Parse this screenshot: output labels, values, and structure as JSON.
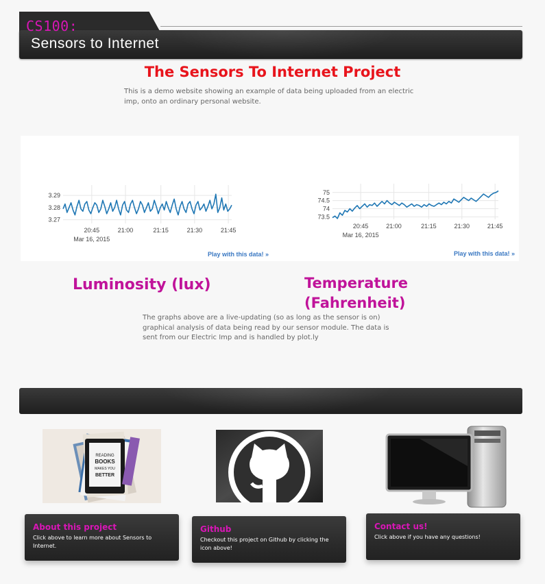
{
  "header": {
    "course_code": "CS100:",
    "site_title": "Sensors to Internet"
  },
  "intro": {
    "title": "The Sensors To Internet Project",
    "text": "This is a demo website showing an example of data being uploaded from an electric imp, onto an ordinary personal website."
  },
  "charts": {
    "play_link": "Play with this data! »",
    "labels": {
      "luminosity": "Luminosity (lux)",
      "temperature": "Temperature (Fahrenheit)"
    },
    "description": "The graphs above are a live-updating (so as long as the sensor is on) graphical analysis of data being read by our sensor module. The data is sent from our Electric Imp and is handled by plot.ly"
  },
  "chart_data": [
    {
      "type": "line",
      "title": "",
      "xlabel": "",
      "ylabel": "",
      "x_ticks": [
        "20:45",
        "21:00",
        "21:15",
        "21:30",
        "21:45"
      ],
      "x_sublabel": "Mar 16, 2015",
      "y_ticks": [
        3.27,
        3.28,
        3.29
      ],
      "ylim": [
        3.267,
        3.294
      ],
      "xlim_minutes": [
        20.5,
        21.8
      ],
      "line_color": "#1f77b4",
      "grid": true,
      "series": [
        {
          "values": [
            3.279,
            3.283,
            3.276,
            3.28,
            3.284,
            3.278,
            3.274,
            3.281,
            3.286,
            3.279,
            3.277,
            3.283,
            3.285,
            3.278,
            3.275,
            3.28,
            3.284,
            3.282,
            3.276,
            3.279,
            3.286,
            3.281,
            3.275,
            3.279,
            3.284,
            3.277,
            3.28,
            3.286,
            3.279,
            3.274,
            3.282,
            3.285,
            3.278,
            3.276,
            3.283,
            3.286,
            3.28,
            3.275,
            3.279,
            3.285,
            3.282,
            3.276,
            3.28,
            3.284,
            3.277,
            3.279,
            3.286,
            3.281,
            3.275,
            3.28,
            3.283,
            3.278,
            3.285,
            3.28,
            3.276,
            3.282,
            3.287,
            3.279,
            3.274,
            3.281,
            3.285,
            3.279,
            3.276,
            3.283,
            3.285,
            3.279,
            3.275,
            3.282,
            3.285,
            3.278,
            3.28,
            3.283,
            3.277,
            3.281,
            3.286,
            3.279,
            3.283,
            3.291,
            3.276,
            3.28,
            3.288,
            3.278,
            3.283,
            3.277,
            3.279,
            3.282
          ]
        }
      ]
    },
    {
      "type": "line",
      "title": "",
      "xlabel": "",
      "ylabel": "",
      "x_ticks": [
        "20:45",
        "21:00",
        "21:15",
        "21:30",
        "21:45"
      ],
      "x_sublabel": "Mar 16, 2015",
      "y_ticks": [
        73.5,
        74,
        74.5,
        75
      ],
      "ylim": [
        73.35,
        75.2
      ],
      "line_color": "#1f77b4",
      "grid": true,
      "series": [
        {
          "values": [
            73.45,
            73.55,
            73.4,
            73.75,
            73.6,
            73.9,
            73.8,
            74.0,
            73.85,
            74.05,
            74.2,
            74.0,
            74.15,
            74.3,
            74.1,
            74.25,
            74.2,
            74.35,
            74.15,
            74.3,
            74.45,
            74.3,
            74.5,
            74.35,
            74.25,
            74.4,
            74.3,
            74.2,
            74.35,
            74.25,
            74.1,
            74.2,
            74.3,
            74.15,
            74.25,
            74.2,
            74.1,
            74.25,
            74.15,
            74.3,
            74.2,
            74.15,
            74.25,
            74.35,
            74.25,
            74.4,
            74.3,
            74.45,
            74.35,
            74.6,
            74.5,
            74.4,
            74.55,
            74.7,
            74.6,
            74.5,
            74.65,
            74.55,
            74.45,
            74.6,
            74.75,
            74.9,
            74.8,
            74.7,
            74.85,
            74.95,
            75.0,
            75.1
          ]
        }
      ]
    }
  ],
  "cards": [
    {
      "title": "About this project",
      "text": "Click above to learn more about Sensors to Internet.",
      "image": "books-image",
      "image_caption": "READING BOOKS MAKES YOU BETTER"
    },
    {
      "title": "Github",
      "text": "Checkout this project on Github by clicking the icon above!",
      "image": "github-octocat-icon"
    },
    {
      "title": "Contact us!",
      "text": "Click above if you have any questions!",
      "image": "computer-image"
    }
  ]
}
